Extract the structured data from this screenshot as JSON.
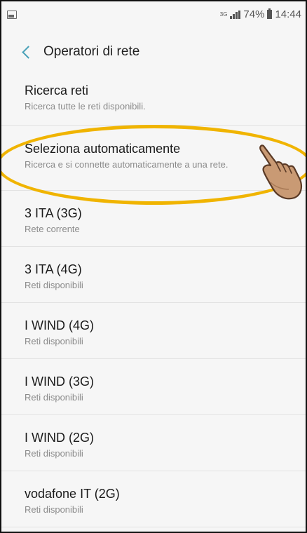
{
  "status_bar": {
    "network_type": "3G",
    "battery_percent": "74%",
    "time": "14:44",
    "icons": [
      "image-icon",
      "signal-icon",
      "battery-icon"
    ]
  },
  "app_bar": {
    "title": "Operatori di rete",
    "back_icon": "chevron-left-icon"
  },
  "menu": {
    "search": {
      "title": "Ricerca reti",
      "subtitle": "Ricerca tutte le reti disponibili."
    },
    "auto": {
      "title": "Seleziona automaticamente",
      "subtitle": "Ricerca e si connette automaticamente a una rete."
    }
  },
  "networks": [
    {
      "name": "3 ITA (3G)",
      "status": "Rete corrente"
    },
    {
      "name": "3 ITA (4G)",
      "status": "Reti disponibili"
    },
    {
      "name": "I WIND (4G)",
      "status": "Reti disponibili"
    },
    {
      "name": "I WIND (3G)",
      "status": "Reti disponibili"
    },
    {
      "name": "I WIND (2G)",
      "status": "Reti disponibili"
    },
    {
      "name": "vodafone IT (2G)",
      "status": "Reti disponibili"
    }
  ],
  "colors": {
    "accent": "#4aa1b8",
    "highlight": "#f0b400",
    "background": "#f6f6f6"
  }
}
